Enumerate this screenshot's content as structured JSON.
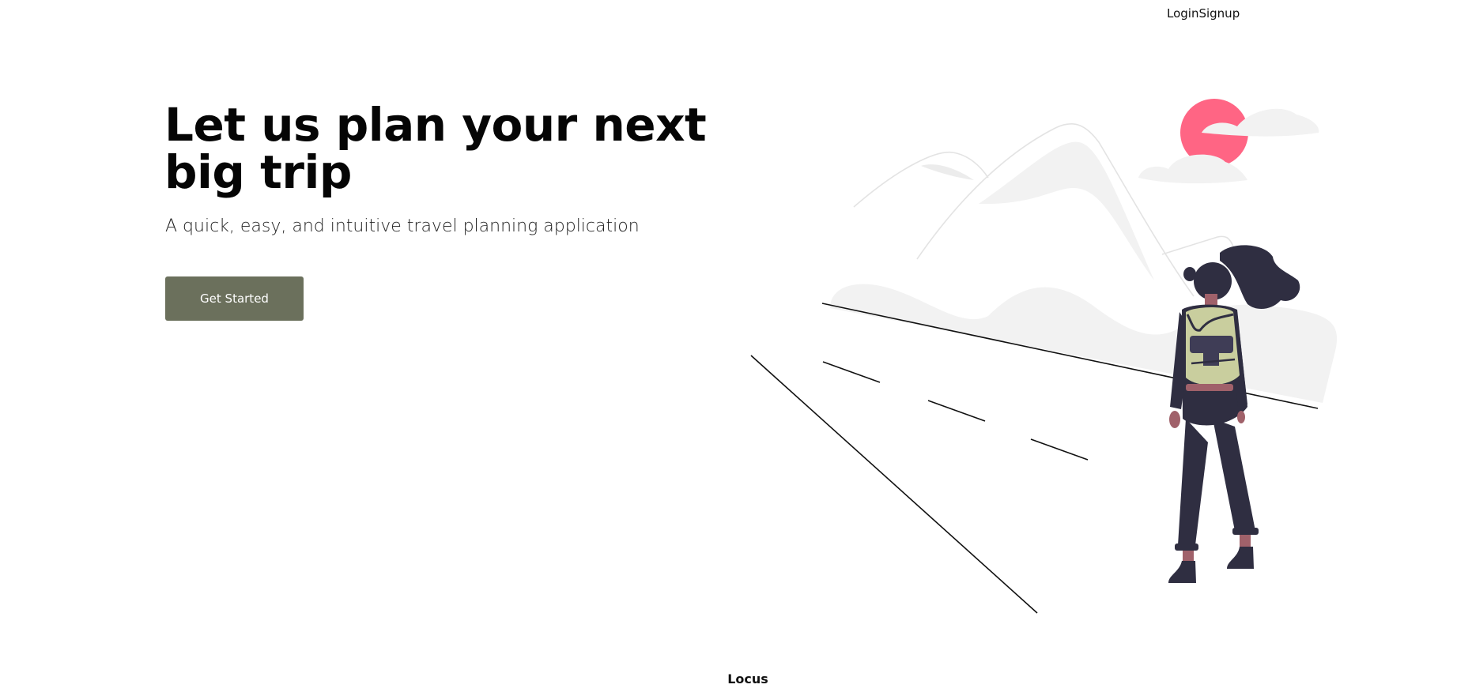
{
  "nav": {
    "login": "Login",
    "signup": "Signup"
  },
  "hero": {
    "title": "Let us plan your next big trip",
    "subtitle": "A quick, easy, and intuitive travel planning application",
    "cta_label": "Get Started"
  },
  "footer": {
    "brand": "Locus"
  },
  "colors": {
    "button": "#6b705c",
    "sun": "#ff6584",
    "backpack": "#c9ce9e",
    "figure": "#2f2e41",
    "scenery": "#f2f2f2"
  },
  "illustration": {
    "icon": "traveler-with-backpack-illustration"
  }
}
